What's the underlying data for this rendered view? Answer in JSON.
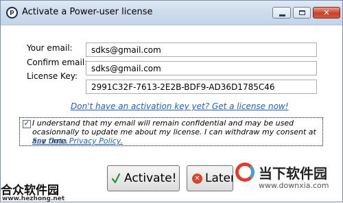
{
  "window": {
    "title": "Activate a Power-user license",
    "app_icon_letter": "p"
  },
  "form": {
    "email_label": "Your email:",
    "email_value": "sdks@gmail.com",
    "confirm_label_line1": "Confirm email:",
    "confirm_value": "sdks@gmail.com",
    "license_label": "License Key:",
    "license_value": "2991C32F-7613-2E2B-BDF9-AD36D1785C46"
  },
  "links": {
    "get_license": "Don't have an activation key yet? Get a license now!"
  },
  "consent": {
    "checked": true,
    "text": "I understand that my email will remain confidential and may be used ocasionnally to update me about my license. I can withdraw my consent at any time.",
    "privacy_link": "See Data Privacy Policy."
  },
  "buttons": {
    "activate": "Activate!",
    "later": "Later"
  },
  "watermarks": {
    "bottom_left": "合众软件园",
    "bottom_left_url": "www.hezhong.net",
    "bottom_right": "当下软件园",
    "bottom_right_url": "www.downxia.com"
  },
  "colors": {
    "link": "#1f5fbf",
    "close_button": "#c8412a"
  }
}
